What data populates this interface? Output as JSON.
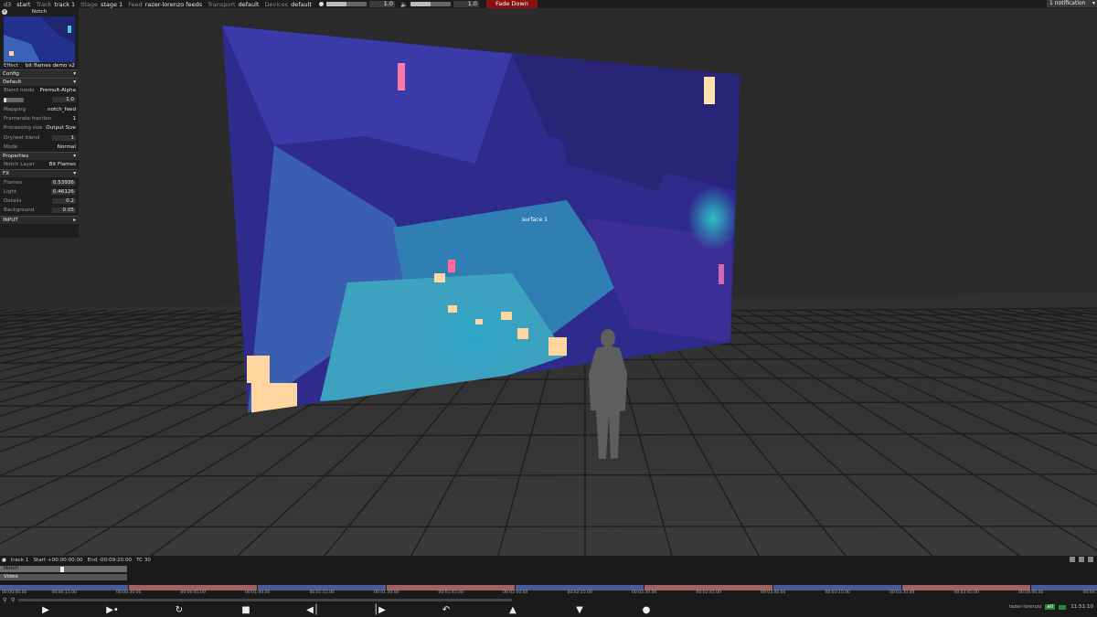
{
  "topbar": {
    "logo": "d3",
    "start": "start",
    "track_key": "Track",
    "track_val": "track 1",
    "stage_key": "Stage",
    "stage_val": "stage 1",
    "feed_key": "Feed",
    "feed_val": "razer-lorenzo feeds",
    "transport_key": "Transport",
    "transport_val": "default",
    "devices_key": "Devices",
    "devices_val": "default",
    "brightness_val": "1.0",
    "volume_val": "1.0",
    "brightness_level": 0.5,
    "volume_level": 0.5,
    "fade_label": "Fade Down",
    "notification": "1 notification"
  },
  "viewport": {
    "surface_label": "surface 1"
  },
  "panel": {
    "title": "Notch",
    "effect_key": "Effect",
    "effect_val": "bit flames demo v2",
    "sections": {
      "config": "Config",
      "default": "Default",
      "properties": "Properties",
      "fx": "FX",
      "input": "INPUT"
    },
    "default_rows": [
      {
        "label": "Blend mode",
        "value": "Premult-Alpha"
      },
      {
        "label": "",
        "value": "1.0"
      },
      {
        "label": "Mapping",
        "value": "notch_feed"
      },
      {
        "label": "Framerate fraction",
        "value": "1"
      },
      {
        "label": "Processing size",
        "value": "Output Size"
      },
      {
        "label": "Dry/wet blend",
        "value": "1"
      },
      {
        "label": "Mode",
        "value": "Normal"
      }
    ],
    "properties_rows": [
      {
        "label": "Notch Layer",
        "value": "Bit Flames"
      }
    ],
    "fx_rows": [
      {
        "label": "Flames",
        "value": "0.53936"
      },
      {
        "label": "Light",
        "value": "0.46126"
      },
      {
        "label": "Details",
        "value": "0.2"
      },
      {
        "label": "Background",
        "value": "0.05"
      }
    ]
  },
  "timeline": {
    "track": "track 1",
    "start": "Start +00:00:00.00",
    "end": "End -00:09:20.00",
    "tc": "TC 30",
    "layers": [
      "Notch",
      "Video"
    ],
    "ruler": [
      "00:00:00.00",
      "00:00:15.00",
      "00:00:30.00",
      "00:00:45.00",
      "00:01:00.00",
      "00:01:15.00",
      "00:01:30.00",
      "00:01:45.00",
      "00:02:00.00",
      "00:02:15.00",
      "00:02:30.00",
      "00:02:45.00",
      "00:03:00.00",
      "00:03:15.00",
      "00:03:30.00",
      "00:03:45.00",
      "00:04:00.00",
      "00:04:15.00"
    ],
    "status_name": "razer-lorenzo",
    "status_badge": "a0",
    "clock": "11:51:10"
  },
  "colors": {
    "fade": "#8a1010",
    "seg_blue": "#4b5a99",
    "seg_red": "#a06262"
  }
}
